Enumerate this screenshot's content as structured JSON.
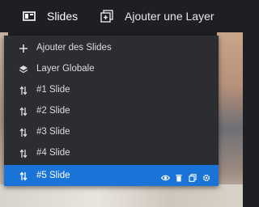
{
  "toolbar": {
    "slides_label": "Slides",
    "add_layer_label": "Ajouter une Layer"
  },
  "menu": {
    "items": [
      {
        "label": "Ajouter des Slides",
        "icon": "plus-icon"
      },
      {
        "label": "Layer Globale",
        "icon": "layers-icon"
      },
      {
        "label": "#1 Slide",
        "icon": "sort-arrows-icon"
      },
      {
        "label": "#2 Slide",
        "icon": "sort-arrows-icon"
      },
      {
        "label": "#3 Slide",
        "icon": "sort-arrows-icon"
      },
      {
        "label": "#4 Slide",
        "icon": "sort-arrows-icon"
      },
      {
        "label": "#5 Slide",
        "icon": "sort-arrows-icon",
        "selected": true,
        "actions": [
          "eye-icon",
          "trash-icon",
          "copy-icon",
          "gear-icon"
        ]
      }
    ]
  },
  "colors": {
    "toolbar_bg": "#1d1f23",
    "menu_bg": "#2b2d31",
    "selected_bg": "#1a73d6",
    "text": "#dcdde0"
  }
}
